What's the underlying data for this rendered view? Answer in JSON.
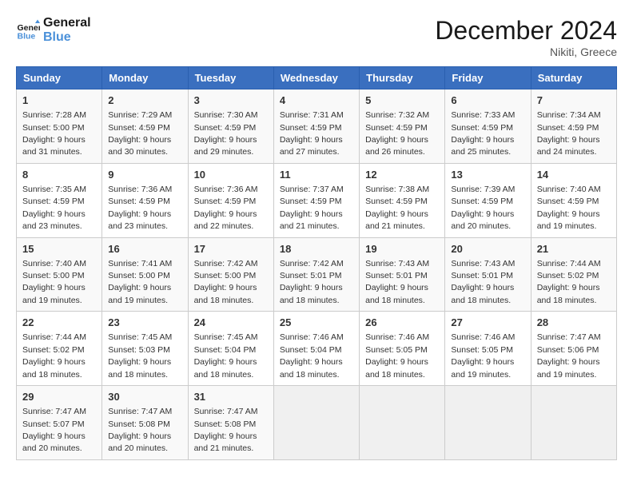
{
  "logo": {
    "line1": "General",
    "line2": "Blue"
  },
  "title": "December 2024",
  "location": "Nikiti, Greece",
  "days_of_week": [
    "Sunday",
    "Monday",
    "Tuesday",
    "Wednesday",
    "Thursday",
    "Friday",
    "Saturday"
  ],
  "weeks": [
    [
      {
        "day": "1",
        "info": "Sunrise: 7:28 AM\nSunset: 5:00 PM\nDaylight: 9 hours\nand 31 minutes."
      },
      {
        "day": "2",
        "info": "Sunrise: 7:29 AM\nSunset: 4:59 PM\nDaylight: 9 hours\nand 30 minutes."
      },
      {
        "day": "3",
        "info": "Sunrise: 7:30 AM\nSunset: 4:59 PM\nDaylight: 9 hours\nand 29 minutes."
      },
      {
        "day": "4",
        "info": "Sunrise: 7:31 AM\nSunset: 4:59 PM\nDaylight: 9 hours\nand 27 minutes."
      },
      {
        "day": "5",
        "info": "Sunrise: 7:32 AM\nSunset: 4:59 PM\nDaylight: 9 hours\nand 26 minutes."
      },
      {
        "day": "6",
        "info": "Sunrise: 7:33 AM\nSunset: 4:59 PM\nDaylight: 9 hours\nand 25 minutes."
      },
      {
        "day": "7",
        "info": "Sunrise: 7:34 AM\nSunset: 4:59 PM\nDaylight: 9 hours\nand 24 minutes."
      }
    ],
    [
      {
        "day": "8",
        "info": "Sunrise: 7:35 AM\nSunset: 4:59 PM\nDaylight: 9 hours\nand 23 minutes."
      },
      {
        "day": "9",
        "info": "Sunrise: 7:36 AM\nSunset: 4:59 PM\nDaylight: 9 hours\nand 23 minutes."
      },
      {
        "day": "10",
        "info": "Sunrise: 7:36 AM\nSunset: 4:59 PM\nDaylight: 9 hours\nand 22 minutes."
      },
      {
        "day": "11",
        "info": "Sunrise: 7:37 AM\nSunset: 4:59 PM\nDaylight: 9 hours\nand 21 minutes."
      },
      {
        "day": "12",
        "info": "Sunrise: 7:38 AM\nSunset: 4:59 PM\nDaylight: 9 hours\nand 21 minutes."
      },
      {
        "day": "13",
        "info": "Sunrise: 7:39 AM\nSunset: 4:59 PM\nDaylight: 9 hours\nand 20 minutes."
      },
      {
        "day": "14",
        "info": "Sunrise: 7:40 AM\nSunset: 4:59 PM\nDaylight: 9 hours\nand 19 minutes."
      }
    ],
    [
      {
        "day": "15",
        "info": "Sunrise: 7:40 AM\nSunset: 5:00 PM\nDaylight: 9 hours\nand 19 minutes."
      },
      {
        "day": "16",
        "info": "Sunrise: 7:41 AM\nSunset: 5:00 PM\nDaylight: 9 hours\nand 19 minutes."
      },
      {
        "day": "17",
        "info": "Sunrise: 7:42 AM\nSunset: 5:00 PM\nDaylight: 9 hours\nand 18 minutes."
      },
      {
        "day": "18",
        "info": "Sunrise: 7:42 AM\nSunset: 5:01 PM\nDaylight: 9 hours\nand 18 minutes."
      },
      {
        "day": "19",
        "info": "Sunrise: 7:43 AM\nSunset: 5:01 PM\nDaylight: 9 hours\nand 18 minutes."
      },
      {
        "day": "20",
        "info": "Sunrise: 7:43 AM\nSunset: 5:01 PM\nDaylight: 9 hours\nand 18 minutes."
      },
      {
        "day": "21",
        "info": "Sunrise: 7:44 AM\nSunset: 5:02 PM\nDaylight: 9 hours\nand 18 minutes."
      }
    ],
    [
      {
        "day": "22",
        "info": "Sunrise: 7:44 AM\nSunset: 5:02 PM\nDaylight: 9 hours\nand 18 minutes."
      },
      {
        "day": "23",
        "info": "Sunrise: 7:45 AM\nSunset: 5:03 PM\nDaylight: 9 hours\nand 18 minutes."
      },
      {
        "day": "24",
        "info": "Sunrise: 7:45 AM\nSunset: 5:04 PM\nDaylight: 9 hours\nand 18 minutes."
      },
      {
        "day": "25",
        "info": "Sunrise: 7:46 AM\nSunset: 5:04 PM\nDaylight: 9 hours\nand 18 minutes."
      },
      {
        "day": "26",
        "info": "Sunrise: 7:46 AM\nSunset: 5:05 PM\nDaylight: 9 hours\nand 18 minutes."
      },
      {
        "day": "27",
        "info": "Sunrise: 7:46 AM\nSunset: 5:05 PM\nDaylight: 9 hours\nand 19 minutes."
      },
      {
        "day": "28",
        "info": "Sunrise: 7:47 AM\nSunset: 5:06 PM\nDaylight: 9 hours\nand 19 minutes."
      }
    ],
    [
      {
        "day": "29",
        "info": "Sunrise: 7:47 AM\nSunset: 5:07 PM\nDaylight: 9 hours\nand 20 minutes."
      },
      {
        "day": "30",
        "info": "Sunrise: 7:47 AM\nSunset: 5:08 PM\nDaylight: 9 hours\nand 20 minutes."
      },
      {
        "day": "31",
        "info": "Sunrise: 7:47 AM\nSunset: 5:08 PM\nDaylight: 9 hours\nand 21 minutes."
      },
      {
        "day": "",
        "info": ""
      },
      {
        "day": "",
        "info": ""
      },
      {
        "day": "",
        "info": ""
      },
      {
        "day": "",
        "info": ""
      }
    ]
  ]
}
